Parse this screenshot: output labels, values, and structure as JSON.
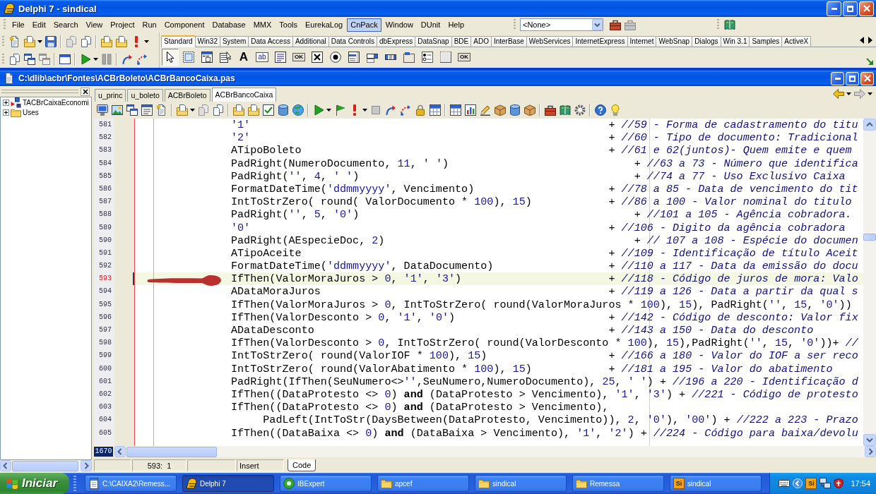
{
  "main_window": {
    "title": "Delphi 7 - sindical"
  },
  "menu_bar": {
    "items": [
      {
        "label": "File",
        "selected": false
      },
      {
        "label": "Edit",
        "selected": false
      },
      {
        "label": "Search",
        "selected": false
      },
      {
        "label": "View",
        "selected": false
      },
      {
        "label": "Project",
        "selected": false
      },
      {
        "label": "Run",
        "selected": false
      },
      {
        "label": "Component",
        "selected": false
      },
      {
        "label": "Database",
        "selected": false
      },
      {
        "label": "MMX",
        "selected": false
      },
      {
        "label": "Tools",
        "selected": false
      },
      {
        "label": "EurekaLog",
        "selected": false
      },
      {
        "label": "CnPack",
        "selected": true
      },
      {
        "label": "Window",
        "selected": false
      },
      {
        "label": "DUnit",
        "selected": false
      },
      {
        "label": "Help",
        "selected": false
      }
    ]
  },
  "desktop_combo": {
    "value": "<None>"
  },
  "component_palette": {
    "tabs": [
      {
        "label": "Standard",
        "selected": true
      },
      {
        "label": "Win32",
        "selected": false
      },
      {
        "label": "System",
        "selected": false
      },
      {
        "label": "Data Access",
        "selected": false
      },
      {
        "label": "Additional",
        "selected": false
      },
      {
        "label": "Data Controls",
        "selected": false
      },
      {
        "label": "dbExpress",
        "selected": false
      },
      {
        "label": "DataSnap",
        "selected": false
      },
      {
        "label": "BDE",
        "selected": false
      },
      {
        "label": "ADO",
        "selected": false
      },
      {
        "label": "InterBase",
        "selected": false
      },
      {
        "label": "WebServices",
        "selected": false
      },
      {
        "label": "InternetExpress",
        "selected": false
      },
      {
        "label": "Internet",
        "selected": false
      },
      {
        "label": "WebSnap",
        "selected": false
      },
      {
        "label": "Dialogs",
        "selected": false
      },
      {
        "label": "Win 3.1",
        "selected": false
      },
      {
        "label": "Samples",
        "selected": false
      },
      {
        "label": "ActiveX",
        "selected": false
      }
    ],
    "components": [
      {
        "kind": "pointer",
        "selected": true
      },
      {
        "kind": "frame",
        "selected": false
      },
      {
        "kind": "mainmenu",
        "selected": false
      },
      {
        "kind": "popupmenu",
        "selected": false
      },
      {
        "kind": "label",
        "selected": false,
        "caption": "A"
      },
      {
        "kind": "edit",
        "selected": false,
        "caption": "ab"
      },
      {
        "kind": "memo",
        "selected": false
      },
      {
        "kind": "button",
        "selected": false,
        "caption": "OK"
      },
      {
        "kind": "checkbox",
        "selected": false
      },
      {
        "kind": "radio",
        "selected": false
      },
      {
        "kind": "listbox",
        "selected": false
      },
      {
        "kind": "combobox",
        "selected": false
      },
      {
        "kind": "scrollbar",
        "selected": false
      },
      {
        "kind": "groupbox",
        "selected": false
      },
      {
        "kind": "radiogroup",
        "selected": false
      },
      {
        "kind": "panel",
        "selected": false
      },
      {
        "kind": "actionlist",
        "selected": false,
        "caption": "OK"
      }
    ]
  },
  "editor_window": {
    "title": "C:\\dlib\\acbr\\Fontes\\ACBrBoleto\\ACBrBancoCaixa.pas"
  },
  "code_explorer": {
    "items": [
      {
        "label": "TACBrCaixaEconomi",
        "kind": "class",
        "expanded": false
      },
      {
        "label": "Uses",
        "kind": "folder",
        "expanded": false
      }
    ]
  },
  "editor_tabs": [
    {
      "label": "u_princ",
      "selected": false
    },
    {
      "label": "u_boleto",
      "selected": false
    },
    {
      "label": "ACBrBoleto",
      "selected": false
    },
    {
      "label": "ACBrBancoCaixa",
      "selected": true
    }
  ],
  "code": {
    "lines": [
      {
        "number": "581",
        "current": false,
        "tokens": [
          {
            "kind": "literal",
            "text": "'1'"
          },
          {
            "kind": "code",
            "text": "                                                        + "
          },
          {
            "kind": "comment",
            "text": "//59 - Forma de cadastramento do titu"
          }
        ]
      },
      {
        "number": "582",
        "current": false,
        "tokens": [
          {
            "kind": "literal",
            "text": "'2'"
          },
          {
            "kind": "code",
            "text": "                                                        + "
          },
          {
            "kind": "comment",
            "text": "//60 - Tipo de documento: Tradicional"
          }
        ]
      },
      {
        "number": "583",
        "current": false,
        "tokens": [
          {
            "kind": "code",
            "text": "ATipoBoleto                                                + "
          },
          {
            "kind": "comment",
            "text": "//61 e 62(juntos)- Quem emite e quem"
          }
        ]
      },
      {
        "number": "584",
        "current": false,
        "tokens": [
          {
            "kind": "code",
            "text": "PadRight(NumeroDocumento, "
          },
          {
            "kind": "literal",
            "text": "11"
          },
          {
            "kind": "code",
            "text": ", "
          },
          {
            "kind": "literal",
            "text": "' '"
          },
          {
            "kind": "code",
            "text": ")                             + "
          },
          {
            "kind": "comment",
            "text": "//63 a 73 - Número que identifica"
          }
        ]
      },
      {
        "number": "585",
        "current": false,
        "tokens": [
          {
            "kind": "code",
            "text": "PadRight("
          },
          {
            "kind": "literal",
            "text": "''"
          },
          {
            "kind": "code",
            "text": ", "
          },
          {
            "kind": "literal",
            "text": "4"
          },
          {
            "kind": "code",
            "text": ", "
          },
          {
            "kind": "literal",
            "text": "' '"
          },
          {
            "kind": "code",
            "text": ")                                           + "
          },
          {
            "kind": "comment",
            "text": "//74 a 77 - Uso Exclusivo Caixa"
          }
        ]
      },
      {
        "number": "586",
        "current": false,
        "tokens": [
          {
            "kind": "code",
            "text": "FormatDateTime("
          },
          {
            "kind": "literal",
            "text": "'ddmmyyyy'"
          },
          {
            "kind": "code",
            "text": ", Vencimento)                     + "
          },
          {
            "kind": "comment",
            "text": "//78 a 85 - Data de vencimento do tit"
          }
        ]
      },
      {
        "number": "587",
        "current": false,
        "tokens": [
          {
            "kind": "code",
            "text": "IntToStrZero( round( ValorDocumento * "
          },
          {
            "kind": "literal",
            "text": "100"
          },
          {
            "kind": "code",
            "text": "), "
          },
          {
            "kind": "literal",
            "text": "15"
          },
          {
            "kind": "code",
            "text": ")            + "
          },
          {
            "kind": "comment",
            "text": "//86 a 100 - Valor nominal do titulo"
          }
        ]
      },
      {
        "number": "588",
        "current": false,
        "tokens": [
          {
            "kind": "code",
            "text": "PadRight("
          },
          {
            "kind": "literal",
            "text": "''"
          },
          {
            "kind": "code",
            "text": ", "
          },
          {
            "kind": "literal",
            "text": "5"
          },
          {
            "kind": "code",
            "text": ", "
          },
          {
            "kind": "literal",
            "text": "'0'"
          },
          {
            "kind": "code",
            "text": ")                                           + "
          },
          {
            "kind": "comment",
            "text": "//101 a 105 - Agência cobradora."
          }
        ]
      },
      {
        "number": "589",
        "current": false,
        "tokens": [
          {
            "kind": "literal",
            "text": "'0'"
          },
          {
            "kind": "code",
            "text": "                                                        + "
          },
          {
            "kind": "comment",
            "text": "//106 - Digito da agência cobradora"
          }
        ]
      },
      {
        "number": "590",
        "current": false,
        "tokens": [
          {
            "kind": "code",
            "text": "PadRight(AEspecieDoc, "
          },
          {
            "kind": "literal",
            "text": "2"
          },
          {
            "kind": "code",
            "text": ")                                       + "
          },
          {
            "kind": "comment",
            "text": "// 107 a 108 - Espécie do documen"
          }
        ]
      },
      {
        "number": "591",
        "current": false,
        "tokens": [
          {
            "kind": "code",
            "text": "ATipoAceite                                                + "
          },
          {
            "kind": "comment",
            "text": "//109 - Identificação de título Aceit"
          }
        ]
      },
      {
        "number": "592",
        "current": false,
        "tokens": [
          {
            "kind": "code",
            "text": "FormatDateTime("
          },
          {
            "kind": "literal",
            "text": "'ddmmyyyy'"
          },
          {
            "kind": "code",
            "text": ", DataDocumento)                  + "
          },
          {
            "kind": "comment",
            "text": "//110 a 117 - Data da emissão do docu"
          }
        ]
      },
      {
        "number": "593",
        "current": true,
        "tokens": [
          {
            "kind": "code",
            "text": "IfThen(ValorMoraJuros > "
          },
          {
            "kind": "literal",
            "text": "0"
          },
          {
            "kind": "code",
            "text": ", "
          },
          {
            "kind": "literal",
            "text": "'1'"
          },
          {
            "kind": "code",
            "text": ", "
          },
          {
            "kind": "literal",
            "text": "'3'"
          },
          {
            "kind": "code",
            "text": ")                       + "
          },
          {
            "kind": "comment",
            "text": "//118 - Código de juros de mora: Valo"
          }
        ]
      },
      {
        "number": "594",
        "current": false,
        "tokens": [
          {
            "kind": "code",
            "text": "ADataMoraJuros                                             + "
          },
          {
            "kind": "comment",
            "text": "//119 a 126 - Data a partir da qual s"
          }
        ]
      },
      {
        "number": "595",
        "current": false,
        "tokens": [
          {
            "kind": "code",
            "text": "IfThen(ValorMoraJuros > "
          },
          {
            "kind": "literal",
            "text": "0"
          },
          {
            "kind": "code",
            "text": ", IntToStrZero( round(ValorMoraJuros * "
          },
          {
            "kind": "literal",
            "text": "100"
          },
          {
            "kind": "code",
            "text": "), "
          },
          {
            "kind": "literal",
            "text": "15"
          },
          {
            "kind": "code",
            "text": "), PadRight("
          },
          {
            "kind": "literal",
            "text": "''"
          },
          {
            "kind": "code",
            "text": ", "
          },
          {
            "kind": "literal",
            "text": "15"
          },
          {
            "kind": "code",
            "text": ", "
          },
          {
            "kind": "literal",
            "text": "'0'"
          },
          {
            "kind": "code",
            "text": "))"
          }
        ]
      },
      {
        "number": "596",
        "current": false,
        "tokens": [
          {
            "kind": "code",
            "text": "IfThen(ValorDesconto > "
          },
          {
            "kind": "literal",
            "text": "0"
          },
          {
            "kind": "code",
            "text": ", "
          },
          {
            "kind": "literal",
            "text": "'1'"
          },
          {
            "kind": "code",
            "text": ", "
          },
          {
            "kind": "literal",
            "text": "'0'"
          },
          {
            "kind": "code",
            "text": ")                        + "
          },
          {
            "kind": "comment",
            "text": "//142 - Código de desconto: Valor fix"
          }
        ]
      },
      {
        "number": "597",
        "current": false,
        "tokens": [
          {
            "kind": "code",
            "text": "ADataDesconto                                              + "
          },
          {
            "kind": "comment",
            "text": "//143 a 150 - Data do desconto"
          }
        ]
      },
      {
        "number": "598",
        "current": false,
        "tokens": [
          {
            "kind": "code",
            "text": "IfThen(ValorDesconto > "
          },
          {
            "kind": "literal",
            "text": "0"
          },
          {
            "kind": "code",
            "text": ", IntToStrZero( round(ValorDesconto * "
          },
          {
            "kind": "literal",
            "text": "100"
          },
          {
            "kind": "code",
            "text": "), "
          },
          {
            "kind": "literal",
            "text": "15"
          },
          {
            "kind": "code",
            "text": "),PadRight("
          },
          {
            "kind": "literal",
            "text": "''"
          },
          {
            "kind": "code",
            "text": ", "
          },
          {
            "kind": "literal",
            "text": "15"
          },
          {
            "kind": "code",
            "text": ", "
          },
          {
            "kind": "literal",
            "text": "'0'"
          },
          {
            "kind": "code",
            "text": "))+ "
          },
          {
            "kind": "comment",
            "text": "//"
          }
        ]
      },
      {
        "number": "599",
        "current": false,
        "tokens": [
          {
            "kind": "code",
            "text": "IntToStrZero( round(ValorIOF * "
          },
          {
            "kind": "literal",
            "text": "100"
          },
          {
            "kind": "code",
            "text": "), "
          },
          {
            "kind": "literal",
            "text": "15"
          },
          {
            "kind": "code",
            "text": ")                   + "
          },
          {
            "kind": "comment",
            "text": "//166 a 180 - Valor do IOF a ser reco"
          }
        ]
      },
      {
        "number": "600",
        "current": false,
        "tokens": [
          {
            "kind": "code",
            "text": "IntToStrZero( round(ValorAbatimento * "
          },
          {
            "kind": "literal",
            "text": "100"
          },
          {
            "kind": "code",
            "text": "), "
          },
          {
            "kind": "literal",
            "text": "15"
          },
          {
            "kind": "code",
            "text": ")            + "
          },
          {
            "kind": "comment",
            "text": "//181 a 195 - Valor do abatimento"
          }
        ]
      },
      {
        "number": "601",
        "current": false,
        "tokens": [
          {
            "kind": "code",
            "text": "PadRight(IfThen(SeuNumero<>"
          },
          {
            "kind": "literal",
            "text": "''"
          },
          {
            "kind": "code",
            "text": ",SeuNumero,NumeroDocumento), "
          },
          {
            "kind": "literal",
            "text": "25"
          },
          {
            "kind": "code",
            "text": ", "
          },
          {
            "kind": "literal",
            "text": "' '"
          },
          {
            "kind": "code",
            "text": ") + "
          },
          {
            "kind": "comment",
            "text": "//196 a 220 - Identificação d"
          }
        ]
      },
      {
        "number": "602",
        "current": false,
        "tokens": [
          {
            "kind": "code",
            "text": "IfThen((DataProtesto <> "
          },
          {
            "kind": "literal",
            "text": "0"
          },
          {
            "kind": "code",
            "text": ") "
          },
          {
            "kind": "keyword",
            "text": "and"
          },
          {
            "kind": "code",
            "text": " (DataProtesto > Vencimento), "
          },
          {
            "kind": "literal",
            "text": "'1'"
          },
          {
            "kind": "code",
            "text": ", "
          },
          {
            "kind": "literal",
            "text": "'3'"
          },
          {
            "kind": "code",
            "text": ") + "
          },
          {
            "kind": "comment",
            "text": "//221 - Código de protesto"
          }
        ]
      },
      {
        "number": "603",
        "current": false,
        "tokens": [
          {
            "kind": "code",
            "text": "IfThen((DataProtesto <> "
          },
          {
            "kind": "literal",
            "text": "0"
          },
          {
            "kind": "code",
            "text": ") "
          },
          {
            "kind": "keyword",
            "text": "and"
          },
          {
            "kind": "code",
            "text": " (DataProtesto > Vencimento),"
          }
        ]
      },
      {
        "number": "604",
        "current": false,
        "tokens": [
          {
            "kind": "code",
            "text": "     PadLeft(IntToStr(DaysBetween(DataProtesto, Vencimento)), "
          },
          {
            "kind": "literal",
            "text": "2"
          },
          {
            "kind": "code",
            "text": ", "
          },
          {
            "kind": "literal",
            "text": "'0'"
          },
          {
            "kind": "code",
            "text": "), "
          },
          {
            "kind": "literal",
            "text": "'00'"
          },
          {
            "kind": "code",
            "text": ") + "
          },
          {
            "kind": "comment",
            "text": "//222 a 223 - Prazo"
          }
        ]
      },
      {
        "number": "605",
        "current": false,
        "tokens": [
          {
            "kind": "code",
            "text": "IfThen((DataBaixa <> "
          },
          {
            "kind": "literal",
            "text": "0"
          },
          {
            "kind": "code",
            "text": ") "
          },
          {
            "kind": "keyword",
            "text": "and"
          },
          {
            "kind": "code",
            "text": " (DataBaixa > Vencimento), "
          },
          {
            "kind": "literal",
            "text": "'1'"
          },
          {
            "kind": "code",
            "text": ", "
          },
          {
            "kind": "literal",
            "text": "'2'"
          },
          {
            "kind": "code",
            "text": ") + "
          },
          {
            "kind": "comment",
            "text": "//224 - Código para baixa/devolu"
          }
        ]
      }
    ],
    "line_count": "1670"
  },
  "status_bar": {
    "position": "593:  1",
    "mode": "Insert",
    "view_tabs": [
      {
        "label": "Code",
        "selected": true
      }
    ]
  },
  "taskbar": {
    "start": "Iniciar",
    "buttons": [
      {
        "label": "C:\\CAIXA2\\Remess...",
        "kind": "notepad",
        "selected": false
      },
      {
        "label": "Delphi 7",
        "kind": "delphi",
        "selected": true
      },
      {
        "label": "IBExpert",
        "kind": "database",
        "selected": false
      },
      {
        "label": "apcef",
        "kind": "folder",
        "selected": false
      },
      {
        "label": "sindical",
        "kind": "folder",
        "selected": false
      },
      {
        "label": "Remessa",
        "kind": "folder",
        "selected": false
      },
      {
        "label": "sindical",
        "kind": "app",
        "selected": false,
        "badge": "Si"
      }
    ],
    "tray_badge": "Si",
    "clock": "17:54"
  }
}
